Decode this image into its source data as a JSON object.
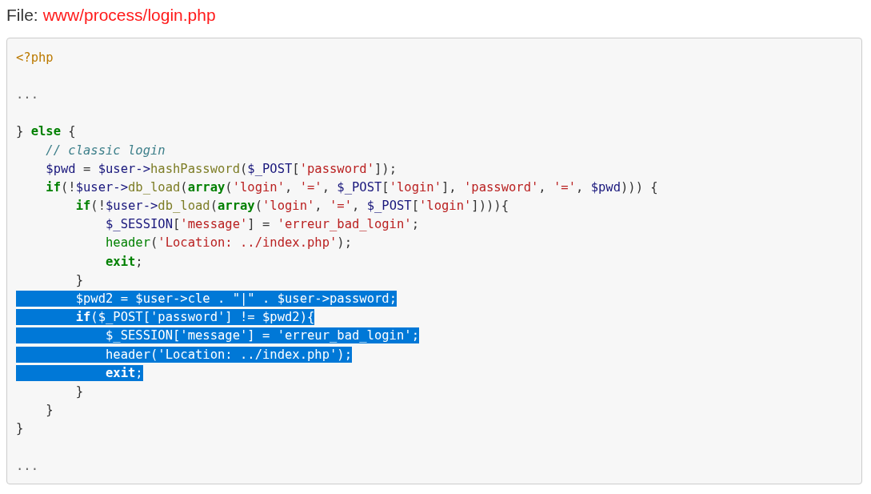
{
  "file": {
    "label": "File:",
    "path": "www/process/login.php"
  },
  "code": {
    "lines": [
      {
        "kind": "code",
        "selected": false,
        "tokens": [
          {
            "kind": "tag",
            "text": "<?php"
          }
        ]
      },
      {
        "kind": "blank",
        "selected": false
      },
      {
        "kind": "code",
        "selected": false,
        "tokens": [
          {
            "kind": "muted",
            "text": "..."
          }
        ]
      },
      {
        "kind": "blank",
        "selected": false
      },
      {
        "kind": "code",
        "selected": false,
        "tokens": [
          {
            "kind": "punct",
            "text": "} "
          },
          {
            "kind": "keyword",
            "text": "else"
          },
          {
            "kind": "punct",
            "text": " {"
          }
        ]
      },
      {
        "kind": "code",
        "selected": false,
        "tokens": [
          {
            "kind": "comment",
            "text": "    // classic login"
          }
        ]
      },
      {
        "kind": "code",
        "selected": false,
        "tokens": [
          {
            "kind": "variable",
            "text": "    $pwd"
          },
          {
            "kind": "punct",
            "text": " = "
          },
          {
            "kind": "variable",
            "text": "$user->"
          },
          {
            "kind": "function",
            "text": "hashPassword"
          },
          {
            "kind": "punct",
            "text": "("
          },
          {
            "kind": "variable",
            "text": "$_POST"
          },
          {
            "kind": "punct",
            "text": "["
          },
          {
            "kind": "string",
            "text": "'password'"
          },
          {
            "kind": "punct",
            "text": "]);"
          }
        ]
      },
      {
        "kind": "code",
        "selected": false,
        "tokens": [
          {
            "kind": "keyword",
            "text": "    if"
          },
          {
            "kind": "punct",
            "text": "(!"
          },
          {
            "kind": "variable",
            "text": "$user->"
          },
          {
            "kind": "function",
            "text": "db_load"
          },
          {
            "kind": "punct",
            "text": "("
          },
          {
            "kind": "keyword",
            "text": "array"
          },
          {
            "kind": "punct",
            "text": "("
          },
          {
            "kind": "string",
            "text": "'login'"
          },
          {
            "kind": "punct",
            "text": ", "
          },
          {
            "kind": "string",
            "text": "'='"
          },
          {
            "kind": "punct",
            "text": ", "
          },
          {
            "kind": "variable",
            "text": "$_POST"
          },
          {
            "kind": "punct",
            "text": "["
          },
          {
            "kind": "string",
            "text": "'login'"
          },
          {
            "kind": "punct",
            "text": "], "
          },
          {
            "kind": "string",
            "text": "'password'"
          },
          {
            "kind": "punct",
            "text": ", "
          },
          {
            "kind": "string",
            "text": "'='"
          },
          {
            "kind": "punct",
            "text": ", "
          },
          {
            "kind": "variable",
            "text": "$pwd"
          },
          {
            "kind": "punct",
            "text": "))) {"
          }
        ]
      },
      {
        "kind": "code",
        "selected": false,
        "tokens": [
          {
            "kind": "keyword",
            "text": "        if"
          },
          {
            "kind": "punct",
            "text": "(!"
          },
          {
            "kind": "variable",
            "text": "$user->"
          },
          {
            "kind": "function",
            "text": "db_load"
          },
          {
            "kind": "punct",
            "text": "("
          },
          {
            "kind": "keyword",
            "text": "array"
          },
          {
            "kind": "punct",
            "text": "("
          },
          {
            "kind": "string",
            "text": "'login'"
          },
          {
            "kind": "punct",
            "text": ", "
          },
          {
            "kind": "string",
            "text": "'='"
          },
          {
            "kind": "punct",
            "text": ", "
          },
          {
            "kind": "variable",
            "text": "$_POST"
          },
          {
            "kind": "punct",
            "text": "["
          },
          {
            "kind": "string",
            "text": "'login'"
          },
          {
            "kind": "punct",
            "text": "]))){"
          }
        ]
      },
      {
        "kind": "code",
        "selected": false,
        "tokens": [
          {
            "kind": "variable",
            "text": "            $_SESSION"
          },
          {
            "kind": "punct",
            "text": "["
          },
          {
            "kind": "string",
            "text": "'message'"
          },
          {
            "kind": "punct",
            "text": "] = "
          },
          {
            "kind": "string",
            "text": "'erreur_bad_login'"
          },
          {
            "kind": "punct",
            "text": ";"
          }
        ]
      },
      {
        "kind": "code",
        "selected": false,
        "tokens": [
          {
            "kind": "builtin",
            "text": "            header"
          },
          {
            "kind": "punct",
            "text": "("
          },
          {
            "kind": "string",
            "text": "'Location: ../index.php'"
          },
          {
            "kind": "punct",
            "text": ");"
          }
        ]
      },
      {
        "kind": "code",
        "selected": false,
        "tokens": [
          {
            "kind": "keyword",
            "text": "            exit"
          },
          {
            "kind": "punct",
            "text": ";"
          }
        ]
      },
      {
        "kind": "code",
        "selected": false,
        "tokens": [
          {
            "kind": "punct",
            "text": "        }"
          }
        ]
      },
      {
        "kind": "code",
        "selected": true,
        "tokens": [
          {
            "kind": "variable",
            "text": "        $pwd2"
          },
          {
            "kind": "punct",
            "text": " = "
          },
          {
            "kind": "variable",
            "text": "$user->cle"
          },
          {
            "kind": "punct",
            "text": " . "
          },
          {
            "kind": "string",
            "text": "\"|\""
          },
          {
            "kind": "punct",
            "text": " . "
          },
          {
            "kind": "variable",
            "text": "$user->password"
          },
          {
            "kind": "punct",
            "text": ";"
          }
        ]
      },
      {
        "kind": "code",
        "selected": true,
        "tokens": [
          {
            "kind": "keyword",
            "text": "        if"
          },
          {
            "kind": "punct",
            "text": "("
          },
          {
            "kind": "variable",
            "text": "$_POST"
          },
          {
            "kind": "punct",
            "text": "["
          },
          {
            "kind": "string",
            "text": "'password'"
          },
          {
            "kind": "punct",
            "text": "] != "
          },
          {
            "kind": "variable",
            "text": "$pwd2"
          },
          {
            "kind": "punct",
            "text": "){"
          }
        ]
      },
      {
        "kind": "code",
        "selected": true,
        "tokens": [
          {
            "kind": "variable",
            "text": "            $_SESSION"
          },
          {
            "kind": "punct",
            "text": "["
          },
          {
            "kind": "string",
            "text": "'message'"
          },
          {
            "kind": "punct",
            "text": "] = "
          },
          {
            "kind": "string",
            "text": "'erreur_bad_login'"
          },
          {
            "kind": "punct",
            "text": ";"
          }
        ]
      },
      {
        "kind": "code",
        "selected": true,
        "tokens": [
          {
            "kind": "builtin",
            "text": "            header"
          },
          {
            "kind": "punct",
            "text": "("
          },
          {
            "kind": "string",
            "text": "'Location: ../index.php'"
          },
          {
            "kind": "punct",
            "text": ");"
          }
        ]
      },
      {
        "kind": "code",
        "selected": true,
        "tokens": [
          {
            "kind": "keyword",
            "text": "            exit"
          },
          {
            "kind": "punct",
            "text": ";"
          }
        ]
      },
      {
        "kind": "code",
        "selected": false,
        "tokens": [
          {
            "kind": "punct",
            "text": "        }"
          }
        ]
      },
      {
        "kind": "code",
        "selected": false,
        "tokens": [
          {
            "kind": "punct",
            "text": "    }"
          }
        ]
      },
      {
        "kind": "code",
        "selected": false,
        "tokens": [
          {
            "kind": "punct",
            "text": "}"
          }
        ]
      },
      {
        "kind": "blank",
        "selected": false
      },
      {
        "kind": "code",
        "selected": false,
        "tokens": [
          {
            "kind": "muted",
            "text": "..."
          }
        ]
      }
    ]
  }
}
